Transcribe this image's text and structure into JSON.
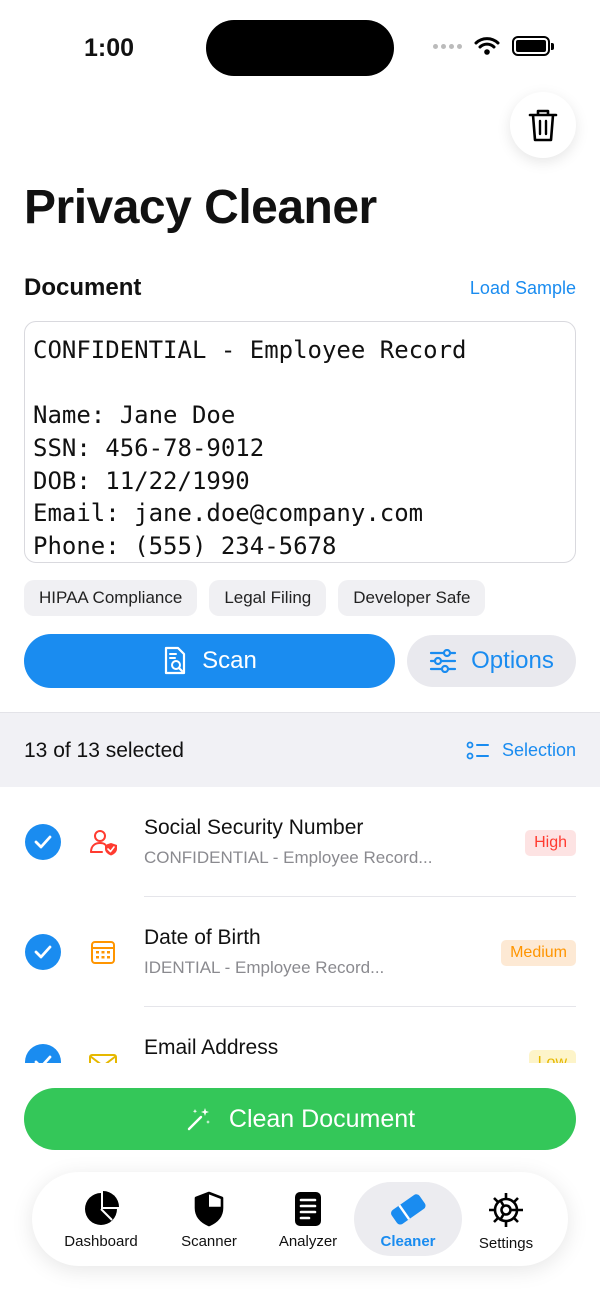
{
  "status_bar": {
    "time": "1:00"
  },
  "header": {
    "title": "Privacy Cleaner"
  },
  "document": {
    "label": "Document",
    "load_sample": "Load Sample",
    "lines": [
      "CONFIDENTIAL - Employee Record",
      "",
      "Name: Jane Doe",
      "SSN: 456-78-9012",
      "DOB: 11/22/1990",
      "Email: jane.doe@company.com",
      "Phone: (555) 234-5678"
    ]
  },
  "presets": [
    "HIPAA Compliance",
    "Legal Filing",
    "Developer Safe"
  ],
  "actions": {
    "scan": "Scan",
    "options": "Options",
    "clean": "Clean Document"
  },
  "selection": {
    "count_text": "13 of 13 selected",
    "button": "Selection"
  },
  "findings": [
    {
      "name": "Social Security Number",
      "context": "CONFIDENTIAL - Employee Record...",
      "severity": "High",
      "icon": "person-shield-icon",
      "checked": true
    },
    {
      "name": "Date of Birth",
      "context": "IDENTIAL - Employee Record...",
      "severity": "Medium",
      "icon": "calendar-icon",
      "checked": true
    },
    {
      "name": "Email Address",
      "context": "",
      "severity": "Low",
      "icon": "envelope-icon",
      "checked": true
    }
  ],
  "tabs": [
    {
      "label": "Dashboard",
      "icon": "pie-chart-icon",
      "active": false
    },
    {
      "label": "Scanner",
      "icon": "shield-icon",
      "active": false
    },
    {
      "label": "Analyzer",
      "icon": "document-text-icon",
      "active": false
    },
    {
      "label": "Cleaner",
      "icon": "eraser-icon",
      "active": true
    },
    {
      "label": "Settings",
      "icon": "gear-icon",
      "active": false
    }
  ],
  "colors": {
    "accent": "#1a8cf0",
    "clean_green": "#34c759",
    "high": "#ff3b30",
    "medium": "#ff9500",
    "low": "#e6b800"
  }
}
